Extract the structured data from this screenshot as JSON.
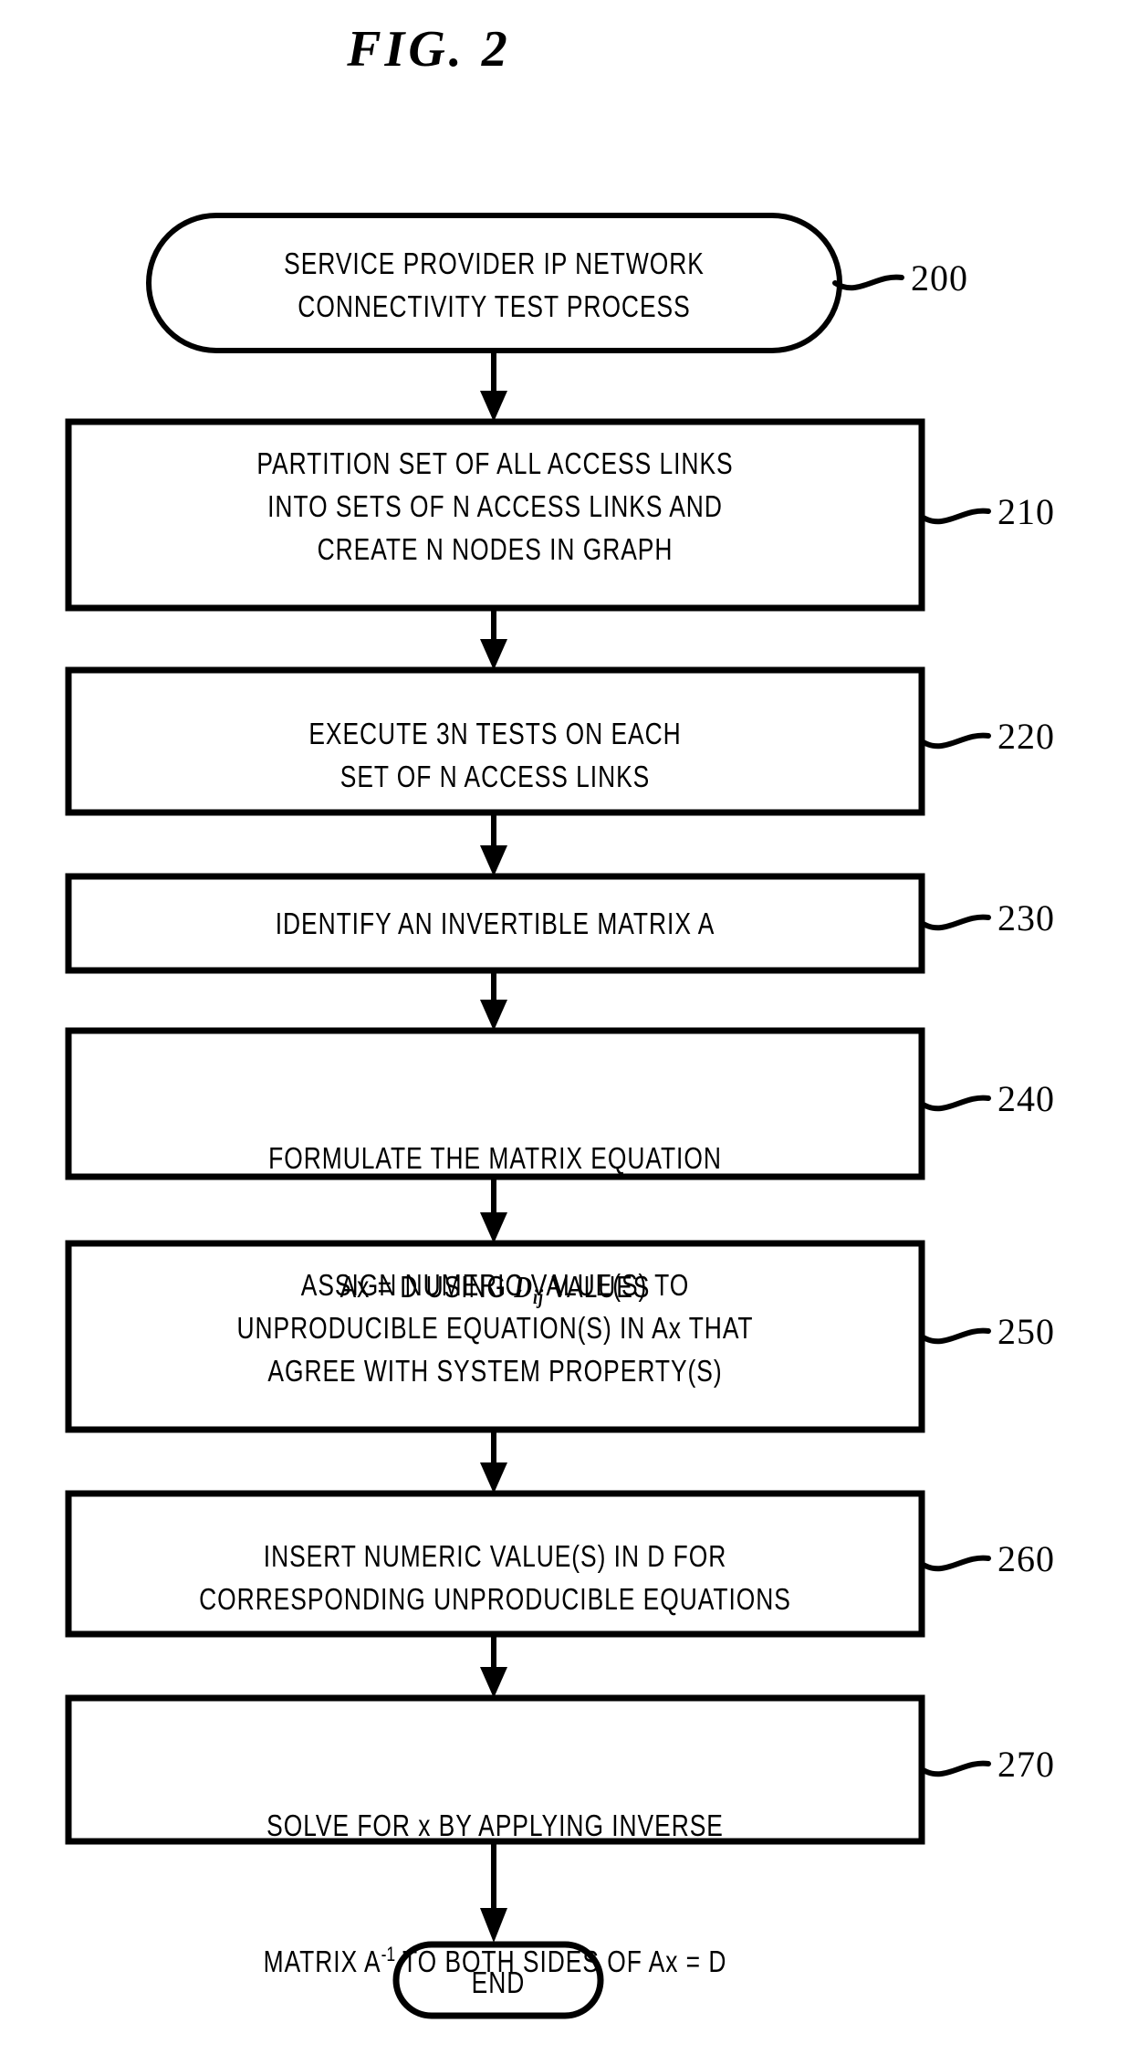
{
  "figure": {
    "title": "FIG. 2"
  },
  "nodes": [
    {
      "id": "start",
      "shape": "terminal",
      "ref": "200",
      "lines": [
        "SERVICE PROVIDER IP NETWORK",
        "CONNECTIVITY TEST PROCESS"
      ],
      "text": "SERVICE PROVIDER IP NETWORK\nCONNECTIVITY TEST PROCESS"
    },
    {
      "id": "step-210",
      "shape": "process",
      "ref": "210",
      "lines": [
        "PARTITION SET OF ALL ACCESS LINKS",
        "INTO SETS OF N ACCESS LINKS AND",
        "CREATE N NODES IN GRAPH"
      ],
      "text": "PARTITION SET OF ALL ACCESS LINKS\nINTO SETS OF N ACCESS LINKS AND\nCREATE N NODES IN GRAPH"
    },
    {
      "id": "step-220",
      "shape": "process",
      "ref": "220",
      "lines": [
        "EXECUTE 3N TESTS ON EACH",
        "SET OF N ACCESS LINKS"
      ],
      "text": "EXECUTE 3N TESTS ON EACH\nSET OF N ACCESS LINKS"
    },
    {
      "id": "step-230",
      "shape": "process",
      "ref": "230",
      "lines": [
        "IDENTIFY AN INVERTIBLE MATRIX A"
      ],
      "text": "IDENTIFY AN INVERTIBLE MATRIX A"
    },
    {
      "id": "step-240",
      "shape": "process",
      "ref": "240",
      "lines": [
        "FORMULATE THE MATRIX EQUATION",
        "Ax = D USING Dij VALUES"
      ],
      "line1": "FORMULATE THE MATRIX EQUATION",
      "line2_prefix": "Ax = D USING ",
      "line2_var": "D",
      "line2_sub": "ij",
      "line2_suffix": " VALUES"
    },
    {
      "id": "step-250",
      "shape": "process",
      "ref": "250",
      "lines": [
        "ASSIGN NUMERIC VALUE(S) TO",
        "UNPRODUCIBLE EQUATION(S) IN Ax THAT",
        "AGREE WITH SYSTEM PROPERTY(S)"
      ],
      "text": "ASSIGN NUMERIC VALUE(S) TO\nUNPRODUCIBLE EQUATION(S) IN Ax THAT\nAGREE WITH SYSTEM PROPERTY(S)"
    },
    {
      "id": "step-260",
      "shape": "process",
      "ref": "260",
      "lines": [
        "INSERT NUMERIC VALUE(S) IN D FOR",
        "CORRESPONDING UNPRODUCIBLE EQUATIONS"
      ],
      "text": "INSERT NUMERIC VALUE(S) IN D FOR\nCORRESPONDING UNPRODUCIBLE EQUATIONS"
    },
    {
      "id": "step-270",
      "shape": "process",
      "ref": "270",
      "lines": [
        "SOLVE FOR x BY APPLYING INVERSE",
        "MATRIX A-1 TO BOTH SIDES OF Ax = D"
      ],
      "line1": "SOLVE FOR x BY APPLYING INVERSE",
      "line2_prefix": "MATRIX A",
      "line2_sup": "-1",
      "line2_suffix": " TO BOTH SIDES OF Ax = D"
    },
    {
      "id": "end",
      "shape": "terminal",
      "ref": "",
      "lines": [
        "END"
      ],
      "text": "END"
    }
  ],
  "reference_numerals": [
    "200",
    "210",
    "220",
    "230",
    "240",
    "250",
    "260",
    "270"
  ],
  "colors": {
    "stroke": "#000000",
    "background": "#ffffff",
    "text": "#000000"
  }
}
